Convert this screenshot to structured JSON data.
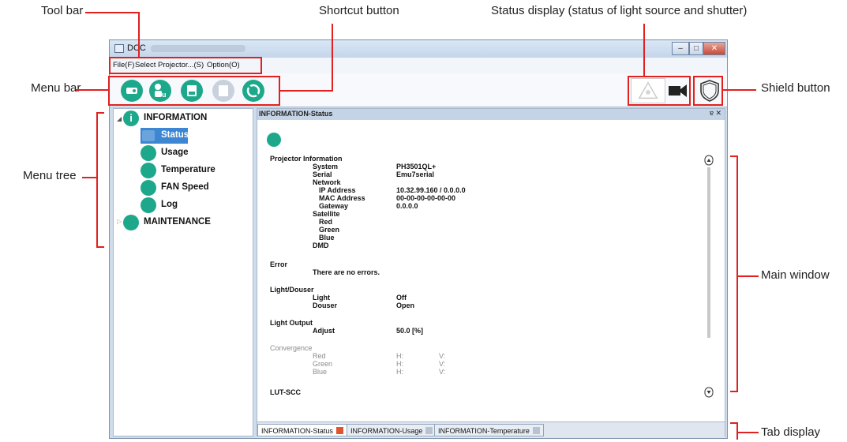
{
  "callouts": {
    "tool_bar": "Tool bar",
    "menu_bar": "Menu bar",
    "menu_tree": "Menu tree",
    "shortcut_button": "Shortcut button",
    "status_display": "Status display (status of light source and shutter)",
    "shield_button": "Shield button",
    "main_window": "Main window",
    "tab_display": "Tab display"
  },
  "window": {
    "title": "DCC",
    "controls": {
      "minimize": "–",
      "maximize": "□",
      "close": "✕"
    }
  },
  "menu": [
    "File(F)",
    "Select Projector...(S)",
    "Option(O)"
  ],
  "tree": {
    "information": "INFORMATION",
    "items": [
      "Status",
      "Usage",
      "Temperature",
      "FAN Speed",
      "Log"
    ],
    "maintenance": "MAINTENANCE",
    "selected": "Status"
  },
  "panel": {
    "title": "INFORMATION-Status",
    "controls": "ɐ ✕"
  },
  "status": {
    "projector_information": "Projector Information",
    "system_label": "System",
    "system_value": "PH3501QL+",
    "serial_label": "Serial",
    "serial_value": "Emu7serial",
    "network_label": "Network",
    "ip_label": "IP Address",
    "ip_value": "10.32.99.160 / 0.0.0.0",
    "mac_label": "MAC Address",
    "mac_value": "00-00-00-00-00-00",
    "gateway_label": "Gateway",
    "gateway_value": "0.0.0.0",
    "satellite_label": "Satellite",
    "red_label": "Red",
    "green_label": "Green",
    "blue_label": "Blue",
    "dmd_label": "DMD",
    "error_heading": "Error",
    "error_text": "There are no errors.",
    "light_douser_heading": "Light/Douser",
    "light_label": "Light",
    "light_value": "Off",
    "douser_label": "Douser",
    "douser_value": "Open",
    "light_output_heading": "Light Output",
    "adjust_label": "Adjust",
    "adjust_value": "50.0  [%]",
    "convergence_heading": "Convergence",
    "conv_h": "H:",
    "conv_v": "V:",
    "lut_heading": "LUT-SCC"
  },
  "tabs": [
    {
      "label": "INFORMATION-Status",
      "active": true
    },
    {
      "label": "INFORMATION-Usage",
      "active": false
    },
    {
      "label": "INFORMATION-Temperature",
      "active": false
    }
  ],
  "colors": {
    "accent": "#1ea88b",
    "callout": "#e0211f",
    "selection": "#3c86d2"
  }
}
